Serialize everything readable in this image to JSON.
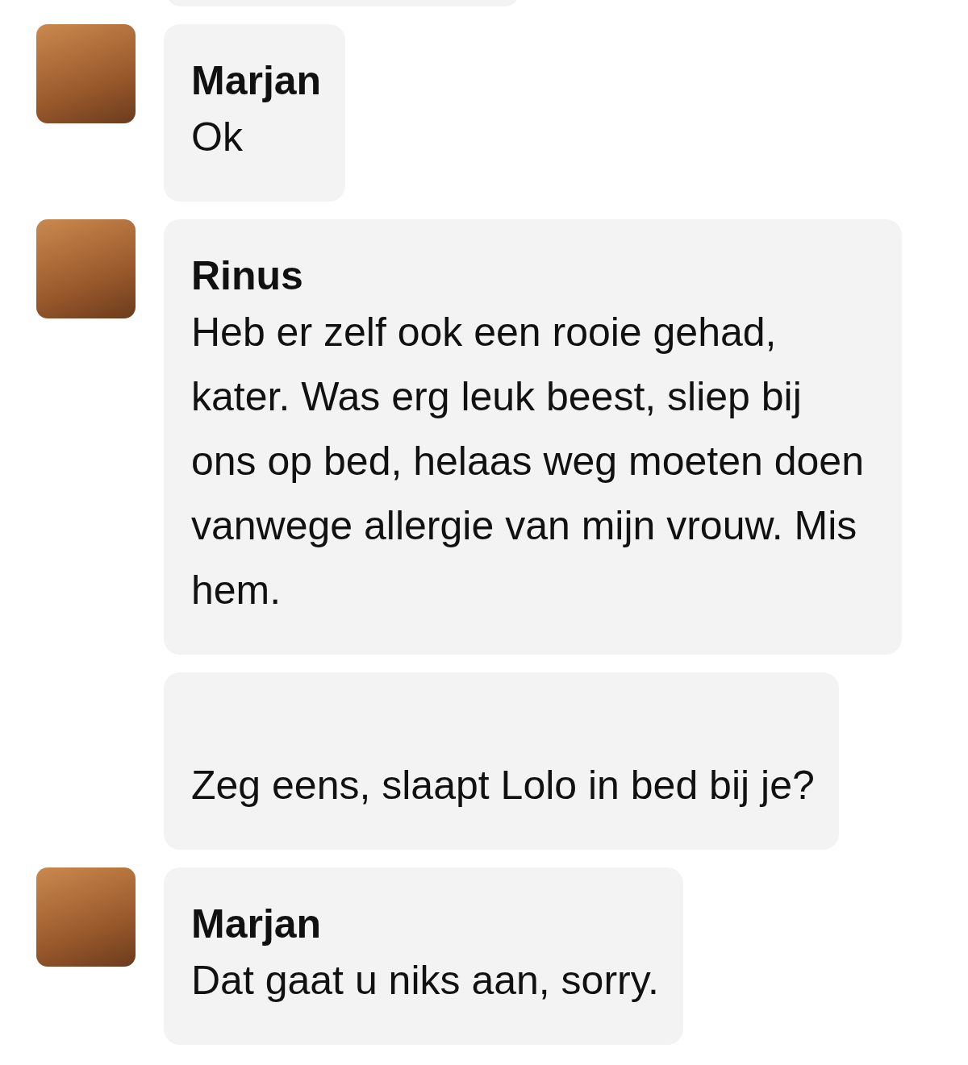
{
  "messages": [
    {
      "kind": "cut"
    },
    {
      "kind": "message",
      "avatar": true,
      "name": "Marjan",
      "text": "Ok"
    },
    {
      "kind": "message",
      "avatar": true,
      "name": "Rinus",
      "text": "Heb er zelf ook een rooie gehad, kater. Was erg leuk beest, sliep bij ons op bed, helaas weg moeten doen vanwege allergie van mijn vrouw. Mis hem."
    },
    {
      "kind": "message",
      "avatar": false,
      "text": "Zeg eens, slaapt Lolo in bed bij je?"
    },
    {
      "kind": "message",
      "avatar": true,
      "name": "Marjan",
      "text": "Dat gaat u niks aan, sorry."
    }
  ]
}
